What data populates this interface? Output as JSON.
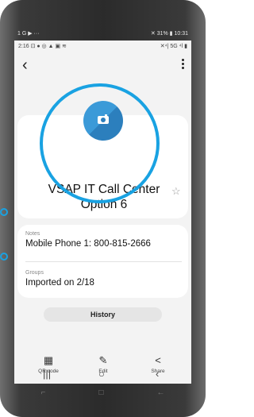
{
  "status_ghost": {
    "left": "1 G ▶ ···",
    "right": "✕ 31% ▮ 10:31"
  },
  "status": {
    "time": "2:16",
    "left_icons": "⊡ ● ◎ ▲ ▣ ≋",
    "right": "✕⁴| 5G ⁴l ▮"
  },
  "contact": {
    "name": "VSAP IT Call Center Option 6",
    "notes_label": "Notes",
    "notes_value": "Mobile Phone 1: 800-815-2666",
    "groups_label": "Groups",
    "groups_value": "Imported on 2/18"
  },
  "history_label": "History",
  "actions": [
    {
      "label": "QR code",
      "icon": "qr-icon"
    },
    {
      "label": "Edit",
      "icon": "pencil-icon"
    },
    {
      "label": "Share",
      "icon": "share-icon"
    }
  ],
  "colors": {
    "accent": "#19a2e2",
    "avatar": "#3b9ad8"
  }
}
